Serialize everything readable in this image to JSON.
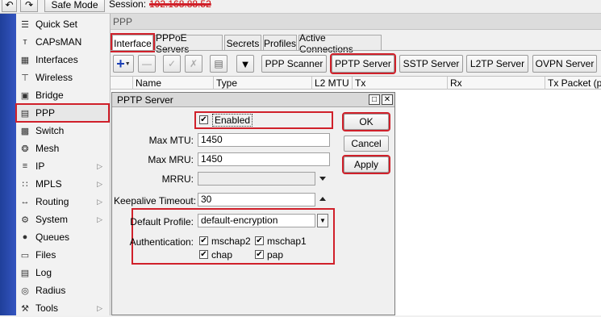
{
  "topbar": {
    "undo_icon": "undo-icon",
    "redo_icon": "redo-icon",
    "safe_mode": "Safe Mode",
    "session_label": "Session:",
    "session_value": "192.168.88.52"
  },
  "sidebar": {
    "items": [
      {
        "label": "Quick Set",
        "icon": "quickset-icon",
        "arrow": false
      },
      {
        "label": "CAPsMAN",
        "icon": "capsman-icon",
        "arrow": false
      },
      {
        "label": "Interfaces",
        "icon": "interfaces-icon",
        "arrow": false
      },
      {
        "label": "Wireless",
        "icon": "wireless-icon",
        "arrow": false
      },
      {
        "label": "Bridge",
        "icon": "bridge-icon",
        "arrow": false
      },
      {
        "label": "PPP",
        "icon": "ppp-icon",
        "arrow": false
      },
      {
        "label": "Switch",
        "icon": "switch-icon",
        "arrow": false
      },
      {
        "label": "Mesh",
        "icon": "mesh-icon",
        "arrow": false
      },
      {
        "label": "IP",
        "icon": "ip-icon",
        "arrow": true
      },
      {
        "label": "MPLS",
        "icon": "mpls-icon",
        "arrow": true
      },
      {
        "label": "Routing",
        "icon": "routing-icon",
        "arrow": true
      },
      {
        "label": "System",
        "icon": "system-icon",
        "arrow": true
      },
      {
        "label": "Queues",
        "icon": "queues-icon",
        "arrow": false
      },
      {
        "label": "Files",
        "icon": "files-icon",
        "arrow": false
      },
      {
        "label": "Log",
        "icon": "log-icon",
        "arrow": false
      },
      {
        "label": "Radius",
        "icon": "radius-icon",
        "arrow": false
      },
      {
        "label": "Tools",
        "icon": "tools-icon",
        "arrow": true
      }
    ]
  },
  "ppp_window": {
    "title": "PPP",
    "tabs": [
      "Interface",
      "PPPoE Servers",
      "Secrets",
      "Profiles",
      "Active Connections"
    ],
    "toolbar": {
      "ppp_scanner": "PPP Scanner",
      "pptp_server": "PPTP Server",
      "sstp_server": "SSTP Server",
      "l2tp_server": "L2TP Server",
      "ovpn_server": "OVPN Server"
    },
    "columns": [
      "Name",
      "Type",
      "L2 MTU",
      "Tx",
      "Rx",
      "Tx Packet (p/s)"
    ]
  },
  "dialog": {
    "title": "PPTP Server",
    "enabled_label": "Enabled",
    "enabled_checked": true,
    "max_mtu_label": "Max MTU:",
    "max_mtu_value": "1450",
    "max_mru_label": "Max MRU:",
    "max_mru_value": "1450",
    "mrru_label": "MRRU:",
    "mrru_value": "",
    "keepalive_label": "Keepalive Timeout:",
    "keepalive_value": "30",
    "default_profile_label": "Default Profile:",
    "default_profile_value": "default-encryption",
    "authentication_label": "Authentication:",
    "auth": {
      "mschap2": "mschap2",
      "mschap1": "mschap1",
      "chap": "chap",
      "pap": "pap"
    },
    "ok": "OK",
    "cancel": "Cancel",
    "apply": "Apply"
  },
  "colors": {
    "highlight": "#d0202a",
    "sidebar_strip": "#2a4aad"
  }
}
